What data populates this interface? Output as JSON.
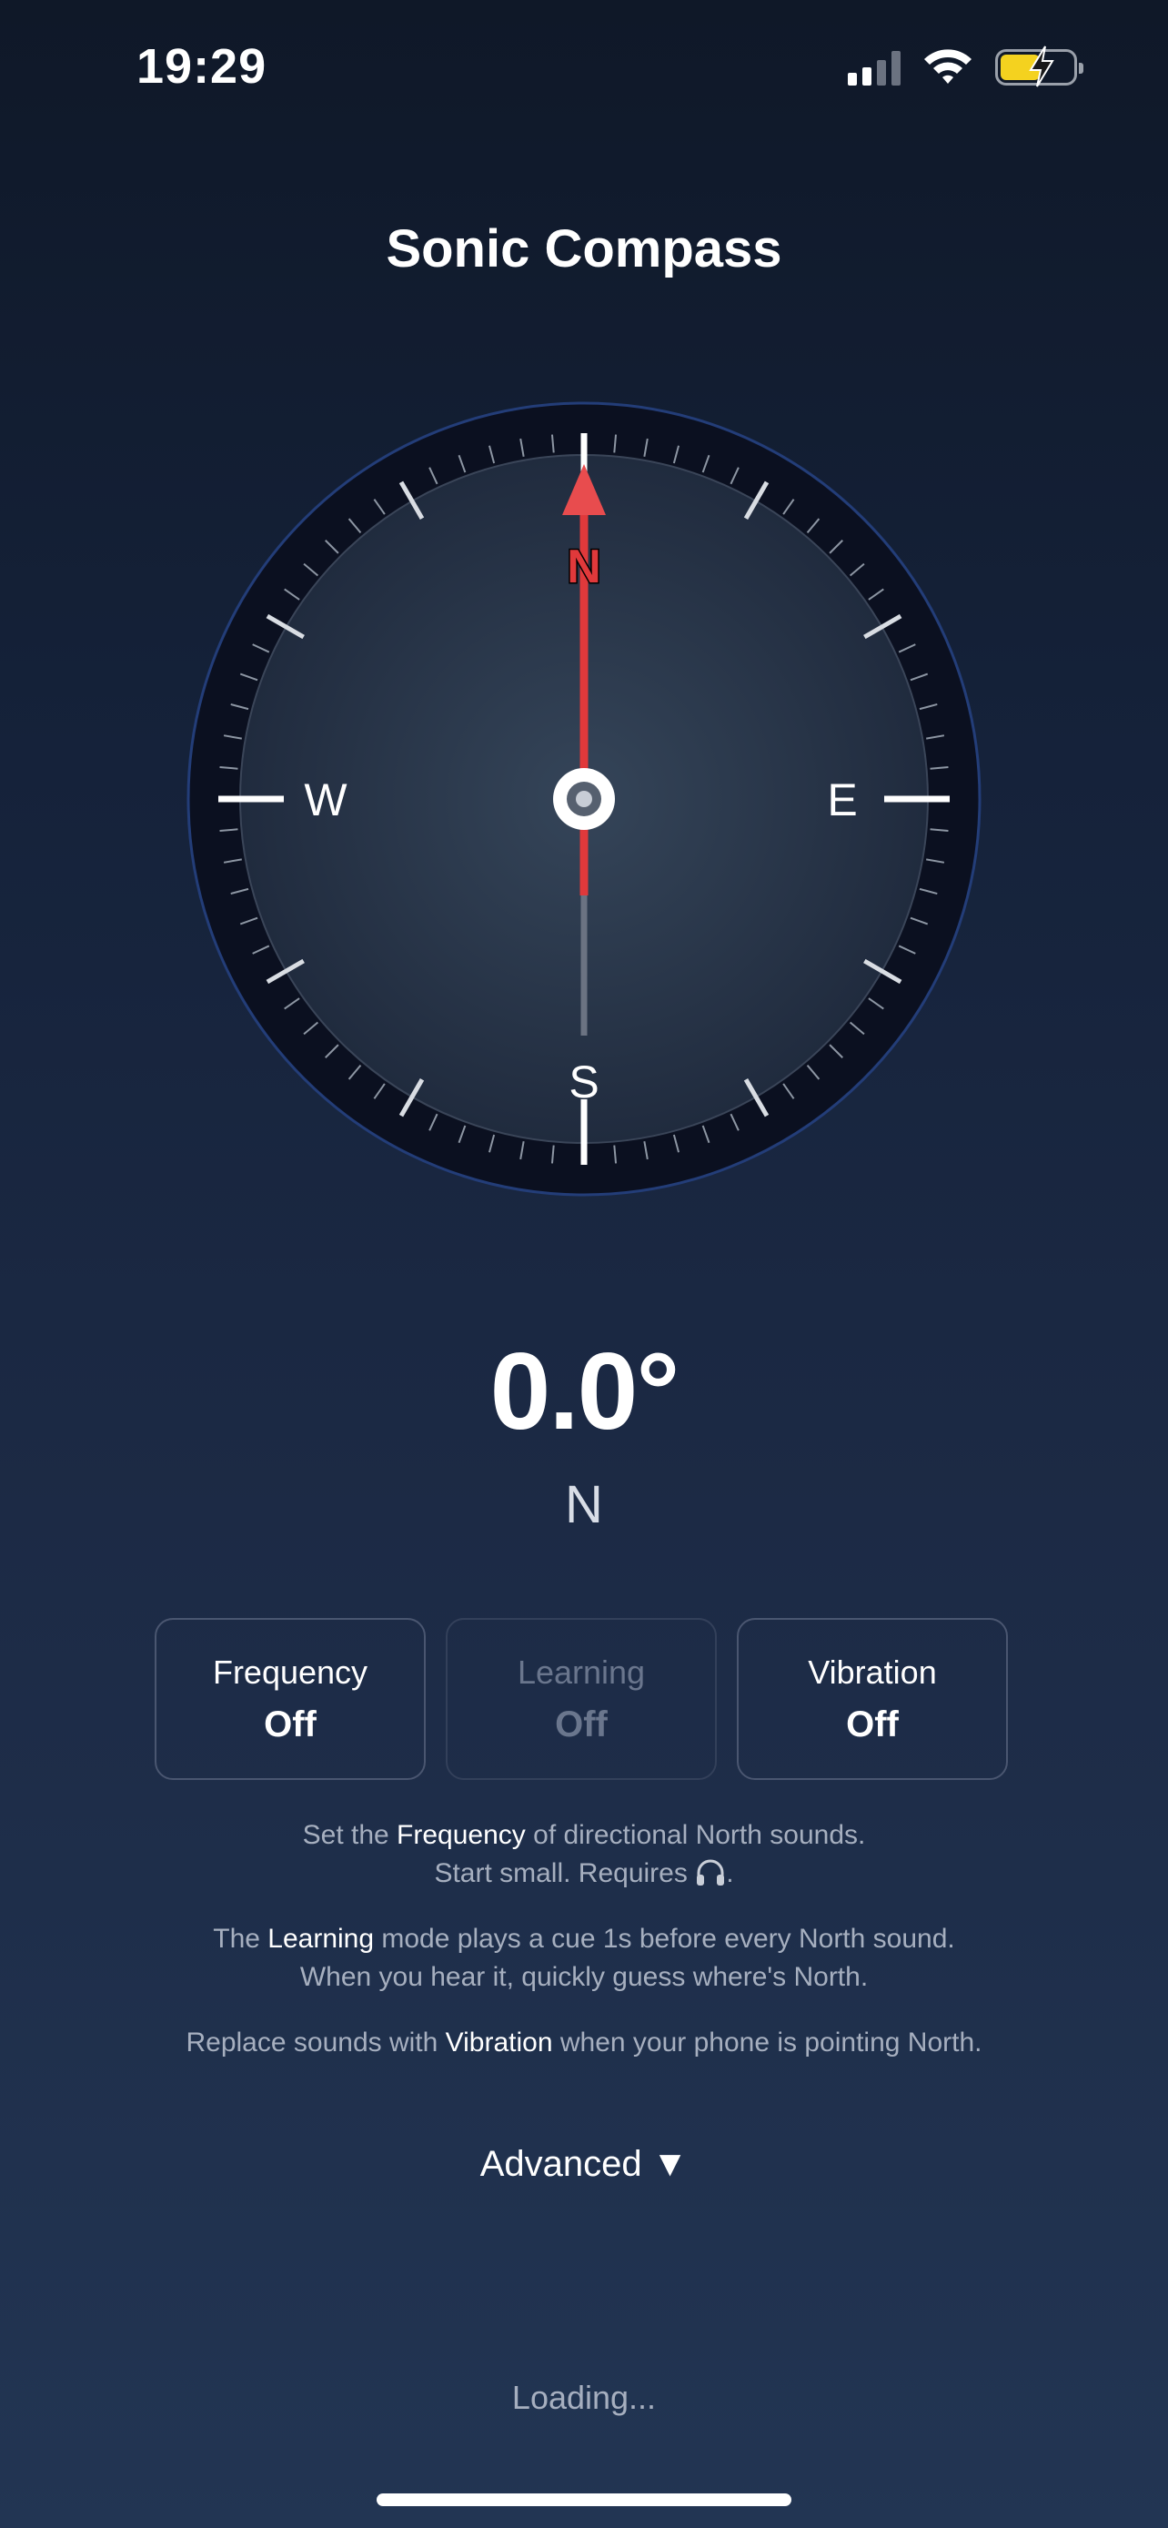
{
  "status_bar": {
    "time": "19:29",
    "battery_level_fraction": 0.55,
    "battery_color": "#f4d21f",
    "charging": true
  },
  "app": {
    "title": "Sonic Compass"
  },
  "compass": {
    "heading_degrees": 0.0,
    "needle_color": "#e0393b",
    "cardinals": {
      "north": "N",
      "east": "E",
      "south": "S",
      "west": "W"
    }
  },
  "readout": {
    "heading": "0.0°",
    "direction": "N"
  },
  "toggles": [
    {
      "label": "Frequency",
      "state": "Off",
      "enabled": true
    },
    {
      "label": "Learning",
      "state": "Off",
      "enabled": false
    },
    {
      "label": "Vibration",
      "state": "Off",
      "enabled": true
    }
  ],
  "help": {
    "frequency": {
      "pre": "Set the ",
      "keyword": "Frequency",
      "post": " of directional North sounds.",
      "line2": "Start small. Requires ",
      "line2_end": "."
    },
    "learning": {
      "pre": "The ",
      "keyword": "Learning",
      "post": " mode plays a cue 1s before every North sound.",
      "line2": "When you hear it, quickly guess where's North."
    },
    "vibration": {
      "pre": "Replace sounds with ",
      "keyword": "Vibration",
      "post": " when your phone is pointing North."
    }
  },
  "advanced": {
    "label": "Advanced ▼"
  },
  "loading": {
    "text": "Loading..."
  }
}
